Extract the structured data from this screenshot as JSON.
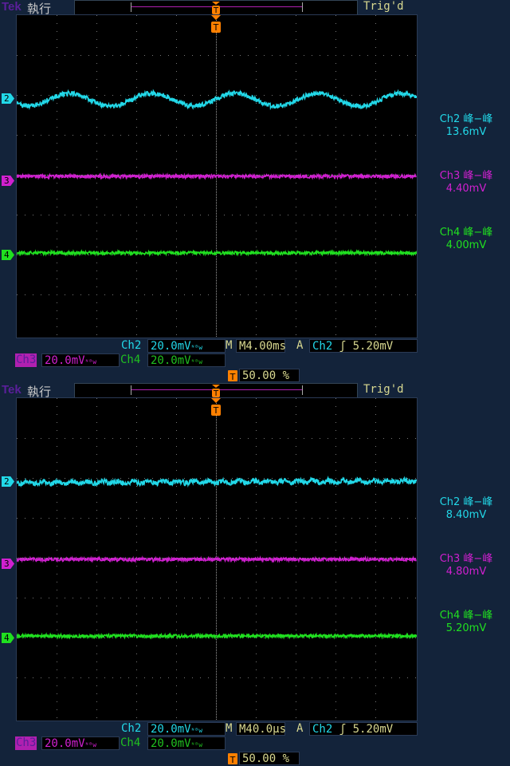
{
  "colors": {
    "ch2": "#22d8e8",
    "ch3": "#d020d0",
    "ch4": "#20e020",
    "trigger": "#ff8000",
    "text": "#d8d890"
  },
  "panels": [
    {
      "brand": "Tek",
      "run_state": "執行",
      "trigger_status": "Trig'd",
      "measurements": [
        {
          "label": "Ch2 峰−峰",
          "value": "13.6mV"
        },
        {
          "label": "Ch3 峰−峰",
          "value": "4.40mV"
        },
        {
          "label": "Ch4 峰−峰",
          "value": "4.00mV"
        }
      ],
      "markers": [
        "2",
        "3",
        "4"
      ],
      "ch2": {
        "name": "Ch2",
        "scale": "20.0mV",
        "bw": "ᴺᴮw"
      },
      "ch3": {
        "name": "Ch3",
        "scale": "20.0mV",
        "bw": "ᴺᴮw"
      },
      "ch4": {
        "name": "Ch4",
        "scale": "20.0mV",
        "bw": "ᴺᴮw"
      },
      "timebase": "M4.00ms",
      "trigger": {
        "mode": "A",
        "source": "Ch2",
        "slope": "ʃ",
        "level": "5.20mV"
      },
      "trigger_position": "50.00 %",
      "trace": "sine"
    },
    {
      "brand": "Tek",
      "run_state": "執行",
      "trigger_status": "Trig'd",
      "measurements": [
        {
          "label": "Ch2 峰−峰",
          "value": "8.40mV"
        },
        {
          "label": "Ch3 峰−峰",
          "value": "4.80mV"
        },
        {
          "label": "Ch4 峰−峰",
          "value": "5.20mV"
        }
      ],
      "markers": [
        "2",
        "3",
        "4"
      ],
      "ch2": {
        "name": "Ch2",
        "scale": "20.0mV",
        "bw": "ᴺᴮw"
      },
      "ch3": {
        "name": "Ch3",
        "scale": "20.0mV",
        "bw": "ᴺᴮw"
      },
      "ch4": {
        "name": "Ch4",
        "scale": "20.0mV",
        "bw": "ᴺᴮw"
      },
      "timebase": "M40.0µs",
      "trigger": {
        "mode": "A",
        "source": "Ch2",
        "slope": "ʃ",
        "level": "5.20mV"
      },
      "trigger_position": "50.00 %",
      "trace": "flat"
    }
  ]
}
